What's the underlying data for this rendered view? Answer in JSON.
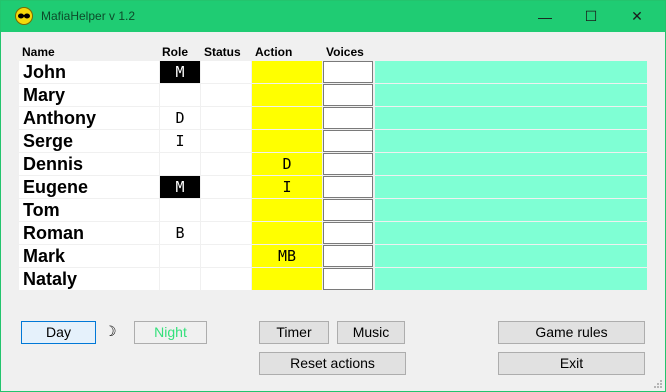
{
  "window": {
    "title": "MafiaHelper v 1.2",
    "minimize_glyph": "—",
    "maximize_glyph": "☐",
    "close_glyph": "✕"
  },
  "columns": {
    "name": "Name",
    "role": "Role",
    "status": "Status",
    "action": "Action",
    "voices": "Voices"
  },
  "players": [
    {
      "name": "John",
      "role": "M",
      "status": "",
      "action": "",
      "voices": ""
    },
    {
      "name": "Mary",
      "role": "",
      "status": "",
      "action": "",
      "voices": ""
    },
    {
      "name": "Anthony",
      "role": "D",
      "status": "",
      "action": "",
      "voices": ""
    },
    {
      "name": "Serge",
      "role": "I",
      "status": "",
      "action": "",
      "voices": ""
    },
    {
      "name": "Dennis",
      "role": "",
      "status": "",
      "action": "D",
      "voices": ""
    },
    {
      "name": "Eugene",
      "role": "M",
      "status": "",
      "action": "I",
      "voices": ""
    },
    {
      "name": "Tom",
      "role": "",
      "status": "",
      "action": "",
      "voices": ""
    },
    {
      "name": "Roman",
      "role": "B",
      "status": "",
      "action": "",
      "voices": ""
    },
    {
      "name": "Mark",
      "role": "",
      "status": "",
      "action": "MB",
      "voices": ""
    },
    {
      "name": "Nataly",
      "role": "",
      "status": "",
      "action": "",
      "voices": ""
    }
  ],
  "buttons": {
    "day": "Day",
    "night": "Night",
    "timer": "Timer",
    "music": "Music",
    "game_rules": "Game rules",
    "reset_actions": "Reset actions",
    "exit": "Exit"
  },
  "icons": {
    "app": "mafia-mask-icon",
    "moon": "moon-icon",
    "moon_glyph": "☽"
  },
  "colors": {
    "titlebar": "#1fcc73",
    "action_cell": "#ffff00",
    "voices_bar": "#7fffd4",
    "mafia_role_cell": "#000000",
    "night_text": "#34e07b"
  }
}
